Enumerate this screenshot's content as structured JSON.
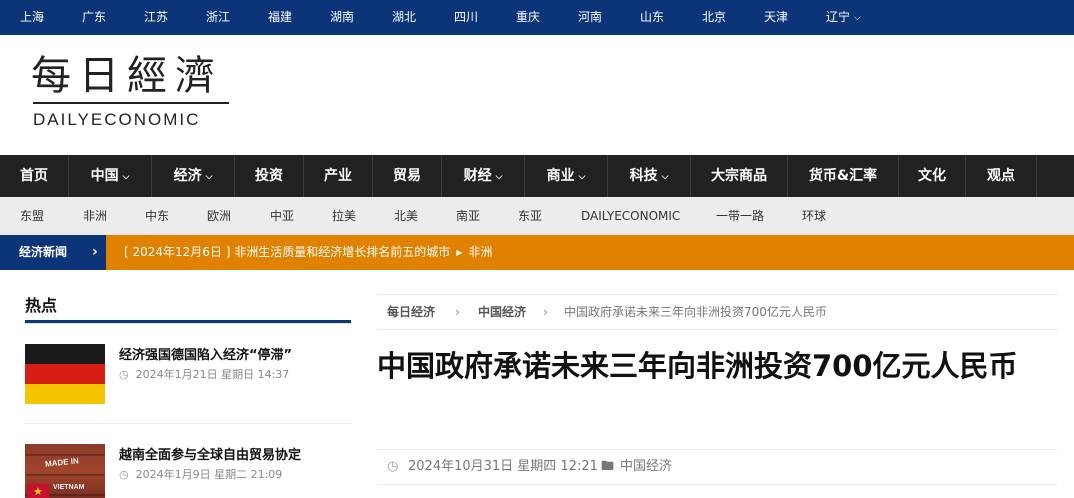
{
  "top_regions": {
    "items": [
      "上海",
      "广东",
      "江苏",
      "浙江",
      "福建",
      "湖南",
      "湖北",
      "四川",
      "重庆",
      "河南",
      "山东",
      "北京",
      "天津",
      "辽宁"
    ],
    "dropdown_item": "辽宁"
  },
  "logo": {
    "chinese": "每日經濟",
    "english": "DAILYECONOMIC"
  },
  "main_nav": {
    "items": [
      {
        "label": "首页"
      },
      {
        "label": "中国",
        "has_dropdown": true
      },
      {
        "label": "经济",
        "has_dropdown": true
      },
      {
        "label": "投资"
      },
      {
        "label": "产业"
      },
      {
        "label": "贸易"
      },
      {
        "label": "财经",
        "has_dropdown": true
      },
      {
        "label": "商业",
        "has_dropdown": true
      },
      {
        "label": "科技",
        "has_dropdown": true
      },
      {
        "label": "大宗商品"
      },
      {
        "label": "货币&汇率"
      },
      {
        "label": "文化"
      },
      {
        "label": "观点"
      }
    ]
  },
  "sub_nav": {
    "items": [
      "东盟",
      "非洲",
      "中东",
      "欧洲",
      "中亚",
      "拉美",
      "北美",
      "南亚",
      "东亚",
      "DAILYECONOMIC",
      "一带一路",
      "环球"
    ]
  },
  "ticker": {
    "label": "经济新闻",
    "text": "[ 2024年12月6日 ]  非洲生活质量和经济增长排名前五的城市",
    "category": "非洲"
  },
  "hot": {
    "title": "热点",
    "items": [
      {
        "title": "经济强国德国陷入经济“停滞”",
        "date": "2024年1月21日 星期日 14:37",
        "thumb": "germany-flag"
      },
      {
        "title": "越南全面参与全球自由贸易协定",
        "date": "2024年1月9日 星期二 21:09",
        "thumb": "shipping-container-vietnam",
        "thumb_text_1": "MADE IN",
        "thumb_text_2": "VIETNAM"
      }
    ]
  },
  "breadcrumb": {
    "home": "每日经济",
    "section": "中国经济",
    "current": "中国政府承诺未来三年向非洲投资700亿元人民币",
    "separator": "›"
  },
  "article": {
    "title": "中国政府承诺未来三年向非洲投资700亿元人民币",
    "date": "2024年10月31日 星期四 12:21",
    "category": "中国经济"
  },
  "colors": {
    "navy": "#0c3478",
    "dark_nav": "#222222",
    "ticker_orange": "#e08100",
    "sub_nav_bg": "#ececec"
  },
  "icons": {
    "chevron": "chevron-down-icon",
    "clock": "clock-icon",
    "folder": "folder-icon",
    "arrow": "chevron-right-icon"
  }
}
